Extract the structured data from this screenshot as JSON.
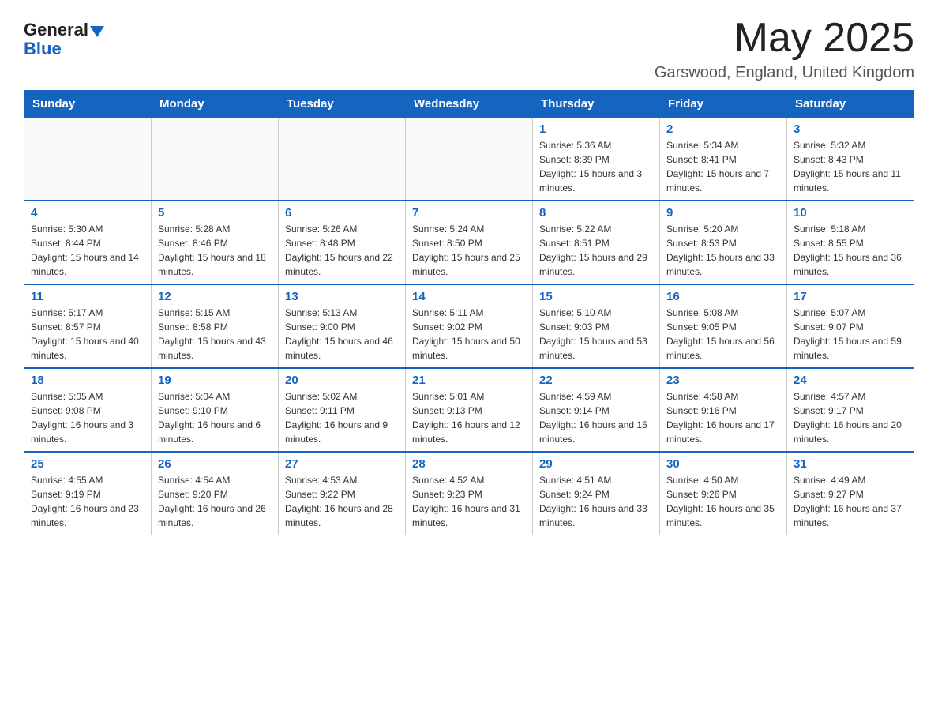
{
  "header": {
    "logo": {
      "general": "General",
      "blue": "Blue",
      "underline": "Blue"
    },
    "title": "May 2025",
    "location": "Garswood, England, United Kingdom"
  },
  "days_of_week": [
    "Sunday",
    "Monday",
    "Tuesday",
    "Wednesday",
    "Thursday",
    "Friday",
    "Saturday"
  ],
  "weeks": [
    [
      {
        "day": "",
        "info": ""
      },
      {
        "day": "",
        "info": ""
      },
      {
        "day": "",
        "info": ""
      },
      {
        "day": "",
        "info": ""
      },
      {
        "day": "1",
        "info": "Sunrise: 5:36 AM\nSunset: 8:39 PM\nDaylight: 15 hours and 3 minutes."
      },
      {
        "day": "2",
        "info": "Sunrise: 5:34 AM\nSunset: 8:41 PM\nDaylight: 15 hours and 7 minutes."
      },
      {
        "day": "3",
        "info": "Sunrise: 5:32 AM\nSunset: 8:43 PM\nDaylight: 15 hours and 11 minutes."
      }
    ],
    [
      {
        "day": "4",
        "info": "Sunrise: 5:30 AM\nSunset: 8:44 PM\nDaylight: 15 hours and 14 minutes."
      },
      {
        "day": "5",
        "info": "Sunrise: 5:28 AM\nSunset: 8:46 PM\nDaylight: 15 hours and 18 minutes."
      },
      {
        "day": "6",
        "info": "Sunrise: 5:26 AM\nSunset: 8:48 PM\nDaylight: 15 hours and 22 minutes."
      },
      {
        "day": "7",
        "info": "Sunrise: 5:24 AM\nSunset: 8:50 PM\nDaylight: 15 hours and 25 minutes."
      },
      {
        "day": "8",
        "info": "Sunrise: 5:22 AM\nSunset: 8:51 PM\nDaylight: 15 hours and 29 minutes."
      },
      {
        "day": "9",
        "info": "Sunrise: 5:20 AM\nSunset: 8:53 PM\nDaylight: 15 hours and 33 minutes."
      },
      {
        "day": "10",
        "info": "Sunrise: 5:18 AM\nSunset: 8:55 PM\nDaylight: 15 hours and 36 minutes."
      }
    ],
    [
      {
        "day": "11",
        "info": "Sunrise: 5:17 AM\nSunset: 8:57 PM\nDaylight: 15 hours and 40 minutes."
      },
      {
        "day": "12",
        "info": "Sunrise: 5:15 AM\nSunset: 8:58 PM\nDaylight: 15 hours and 43 minutes."
      },
      {
        "day": "13",
        "info": "Sunrise: 5:13 AM\nSunset: 9:00 PM\nDaylight: 15 hours and 46 minutes."
      },
      {
        "day": "14",
        "info": "Sunrise: 5:11 AM\nSunset: 9:02 PM\nDaylight: 15 hours and 50 minutes."
      },
      {
        "day": "15",
        "info": "Sunrise: 5:10 AM\nSunset: 9:03 PM\nDaylight: 15 hours and 53 minutes."
      },
      {
        "day": "16",
        "info": "Sunrise: 5:08 AM\nSunset: 9:05 PM\nDaylight: 15 hours and 56 minutes."
      },
      {
        "day": "17",
        "info": "Sunrise: 5:07 AM\nSunset: 9:07 PM\nDaylight: 15 hours and 59 minutes."
      }
    ],
    [
      {
        "day": "18",
        "info": "Sunrise: 5:05 AM\nSunset: 9:08 PM\nDaylight: 16 hours and 3 minutes."
      },
      {
        "day": "19",
        "info": "Sunrise: 5:04 AM\nSunset: 9:10 PM\nDaylight: 16 hours and 6 minutes."
      },
      {
        "day": "20",
        "info": "Sunrise: 5:02 AM\nSunset: 9:11 PM\nDaylight: 16 hours and 9 minutes."
      },
      {
        "day": "21",
        "info": "Sunrise: 5:01 AM\nSunset: 9:13 PM\nDaylight: 16 hours and 12 minutes."
      },
      {
        "day": "22",
        "info": "Sunrise: 4:59 AM\nSunset: 9:14 PM\nDaylight: 16 hours and 15 minutes."
      },
      {
        "day": "23",
        "info": "Sunrise: 4:58 AM\nSunset: 9:16 PM\nDaylight: 16 hours and 17 minutes."
      },
      {
        "day": "24",
        "info": "Sunrise: 4:57 AM\nSunset: 9:17 PM\nDaylight: 16 hours and 20 minutes."
      }
    ],
    [
      {
        "day": "25",
        "info": "Sunrise: 4:55 AM\nSunset: 9:19 PM\nDaylight: 16 hours and 23 minutes."
      },
      {
        "day": "26",
        "info": "Sunrise: 4:54 AM\nSunset: 9:20 PM\nDaylight: 16 hours and 26 minutes."
      },
      {
        "day": "27",
        "info": "Sunrise: 4:53 AM\nSunset: 9:22 PM\nDaylight: 16 hours and 28 minutes."
      },
      {
        "day": "28",
        "info": "Sunrise: 4:52 AM\nSunset: 9:23 PM\nDaylight: 16 hours and 31 minutes."
      },
      {
        "day": "29",
        "info": "Sunrise: 4:51 AM\nSunset: 9:24 PM\nDaylight: 16 hours and 33 minutes."
      },
      {
        "day": "30",
        "info": "Sunrise: 4:50 AM\nSunset: 9:26 PM\nDaylight: 16 hours and 35 minutes."
      },
      {
        "day": "31",
        "info": "Sunrise: 4:49 AM\nSunset: 9:27 PM\nDaylight: 16 hours and 37 minutes."
      }
    ]
  ]
}
